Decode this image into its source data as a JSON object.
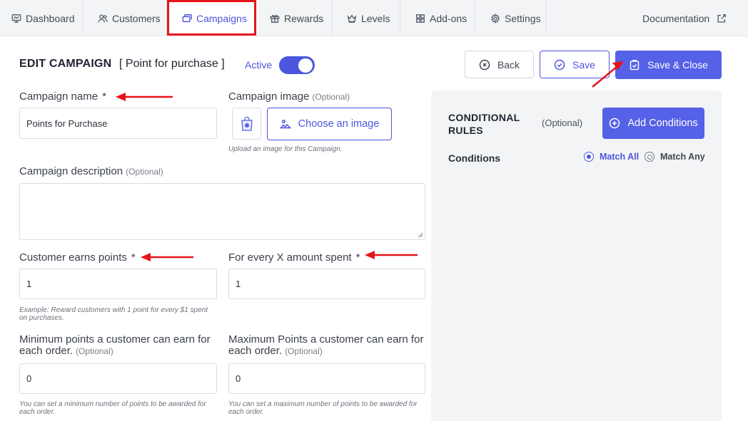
{
  "nav": {
    "tabs": [
      {
        "label": "Dashboard",
        "icon": "dashboard-icon"
      },
      {
        "label": "Customers",
        "icon": "customers-icon"
      },
      {
        "label": "Campaigns",
        "icon": "campaigns-icon",
        "active": true
      },
      {
        "label": "Rewards",
        "icon": "rewards-icon"
      },
      {
        "label": "Levels",
        "icon": "crown-icon"
      },
      {
        "label": "Add-ons",
        "icon": "grid-icon"
      },
      {
        "label": "Settings",
        "icon": "gear-icon"
      }
    ],
    "documentation": "Documentation"
  },
  "header": {
    "title": "EDIT CAMPAIGN",
    "subtitle": "[ Point for purchase ]",
    "active_label": "Active",
    "active_on": true
  },
  "actions": {
    "back": "Back",
    "save": "Save",
    "save_close": "Save & Close"
  },
  "form": {
    "campaign_name": {
      "label": "Campaign name",
      "required": "*",
      "value": "Points for Purchase"
    },
    "campaign_image": {
      "label": "Campaign image",
      "optional": "(Optional)",
      "button": "Choose an image",
      "help": "Upload an image for this Campaign."
    },
    "campaign_description": {
      "label": "Campaign description",
      "optional": "(Optional)",
      "value": ""
    },
    "earn_points": {
      "label": "Customer earns points",
      "required": "*",
      "value": "1",
      "help": "Example: Reward customers with 1 point for every $1 spent on purchases."
    },
    "every_amount": {
      "label": "For every X amount spent",
      "required": "*",
      "value": "1"
    },
    "min_points": {
      "label": "Minimum points a customer can earn for each order.",
      "optional": "(Optional)",
      "value": "0",
      "help": "You can set a minimum number of points to be awarded for each order."
    },
    "max_points": {
      "label": "Maximum Points a customer can earn for each order.",
      "optional": "(Optional)",
      "value": "0",
      "help": "You can set a maximum number of points to be awarded for each order."
    }
  },
  "conditional_rules": {
    "title": "CONDITIONAL RULES",
    "optional": "(Optional)",
    "add_button": "Add Conditions",
    "conditions_label": "Conditions",
    "match_all": "Match All",
    "match_any": "Match Any",
    "selected": "Match All"
  },
  "colors": {
    "accent": "#4c55dd",
    "primary_button": "#5561e6",
    "annotation_red": "#e6131b",
    "panel_bg": "#f3f4f6"
  }
}
